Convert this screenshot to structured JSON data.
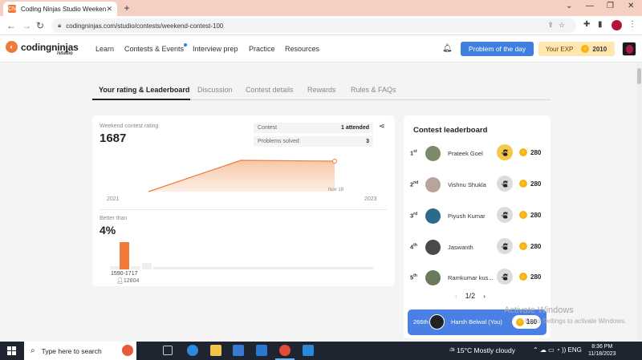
{
  "browser": {
    "tab_title": "Coding Ninjas Studio Weekend",
    "tab_favicon": "CN",
    "new_tab_symbol": "+",
    "url": "codingninjas.com/studio/contests/weekend-contest-100"
  },
  "header": {
    "logo_text": "codingninjas",
    "logo_sub": "/studio",
    "nav": [
      "Learn",
      "Contests & Events",
      "Interview prep",
      "Practice",
      "Resources"
    ],
    "potd_label": "Problem of the day",
    "exp_label": "Your EXP",
    "exp_value": "2010"
  },
  "subtabs": [
    "Your rating & Leaderboard",
    "Discussion",
    "Contest details",
    "Rewards",
    "Rules & FAQs"
  ],
  "rating": {
    "label": "Weekend contest rating",
    "value": "1687",
    "contest_label": "Contest",
    "contest_value": "1 attended",
    "problems_label": "Problems solved",
    "problems_value": "3",
    "chart_start_label": "2021",
    "chart_end_label": "2023",
    "chart_point_label": "Nov 18",
    "better_than_label": "Better than",
    "better_than_value": "4%",
    "range_label": "1590-1717",
    "range_count": "12804"
  },
  "leaderboard": {
    "title": "Contest leaderboard",
    "rows": [
      {
        "rank": "1",
        "suffix": "st",
        "name": "Prateek Goel",
        "score": "280"
      },
      {
        "rank": "2",
        "suffix": "nd",
        "name": "Vishnu Shukla",
        "score": "280"
      },
      {
        "rank": "3",
        "suffix": "rd",
        "name": "Piyush Kumar",
        "score": "280"
      },
      {
        "rank": "4",
        "suffix": "th",
        "name": "Jaswanth",
        "score": "280"
      },
      {
        "rank": "5",
        "suffix": "th",
        "name": "Ramkumar kus...",
        "score": "280"
      }
    ],
    "page": "1/2",
    "you": {
      "rank": "266th",
      "name": "Harsh Belwal (You)",
      "score": "160"
    }
  },
  "watermark": {
    "line1": "Activate Windows",
    "line2": "Go to Settings to activate Windows."
  },
  "taskbar": {
    "search_placeholder": "Type here to search",
    "weather": "15°C  Mostly cloudy",
    "lang": "ENG",
    "time": "8:36 PM",
    "date": "11/18/2023"
  },
  "colors": {
    "accent": "#f07a3a",
    "blue": "#4a7fe3",
    "coin": "#f5b21d"
  },
  "chart_data": {
    "type": "area",
    "x": [
      "2021",
      "Nov 18 2023"
    ],
    "xticks": [
      "2021",
      "2023"
    ],
    "annotation": "Nov 18",
    "histogram": {
      "highlight_range": "1590-1717",
      "highlight_count": "12804"
    }
  }
}
